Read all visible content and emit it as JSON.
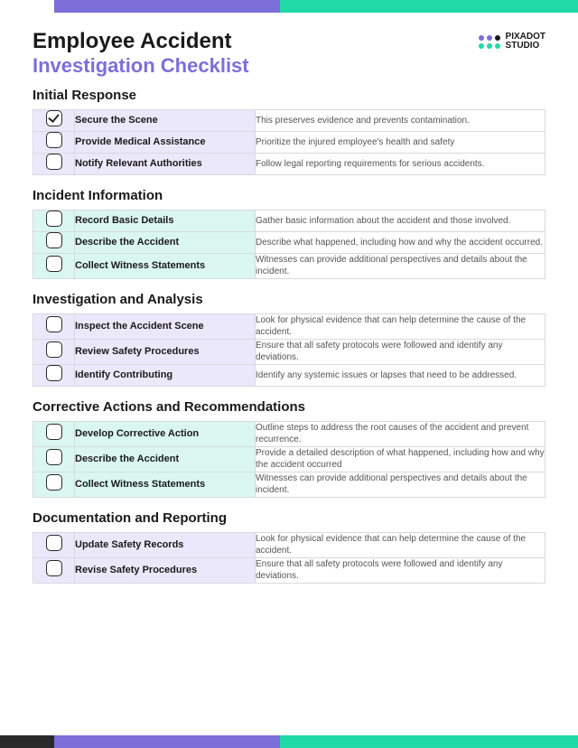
{
  "brand": {
    "line1": "PIXADOT",
    "line2": "STUDIO"
  },
  "title": {
    "line1": "Employee Accident",
    "line2": "Investigation Checklist"
  },
  "sections": [
    {
      "name": "Initial Response",
      "tint": "p",
      "items": [
        {
          "label": "Secure the Scene",
          "desc": "This preserves evidence and prevents contamination.",
          "checked": true
        },
        {
          "label": "Provide Medical Assistance",
          "desc": "Prioritize the injured employee's health and safety",
          "checked": false
        },
        {
          "label": "Notify Relevant Authorities",
          "desc": "Follow legal reporting requirements for serious accidents.",
          "checked": false
        }
      ]
    },
    {
      "name": "Incident Information",
      "tint": "g",
      "items": [
        {
          "label": "Record Basic Details",
          "desc": "Gather basic information about the accident and those involved.",
          "checked": false
        },
        {
          "label": "Describe the Accident",
          "desc": "Describe what happened, including how and why the accident occurred.",
          "checked": false
        },
        {
          "label": "Collect Witness Statements",
          "desc": "Witnesses can provide additional perspectives and details about the incident.",
          "checked": false
        }
      ]
    },
    {
      "name": "Investigation and Analysis",
      "tint": "p",
      "items": [
        {
          "label": "Inspect the Accident Scene",
          "desc": "Look for physical evidence that can help determine the cause of  the accident.",
          "checked": false
        },
        {
          "label": "Review Safety Procedures",
          "desc": "Ensure that all safety protocols were followed and identify any deviations.",
          "checked": false
        },
        {
          "label": "Identify Contributing",
          "desc": "Identify any systemic issues or lapses that need to be addressed.",
          "checked": false
        }
      ]
    },
    {
      "name": "Corrective Actions and Recommendations",
      "tint": "g",
      "items": [
        {
          "label": "Develop Corrective Action",
          "desc": "Outline steps to address the root causes of the accident and prevent recurrence.",
          "checked": false
        },
        {
          "label": "Describe the Accident",
          "desc": "Provide a detailed description of what happened, including how and why the accident occurred",
          "checked": false
        },
        {
          "label": "Collect Witness Statements",
          "desc": "Witnesses can provide additional perspectives and details about the incident.",
          "checked": false
        }
      ]
    },
    {
      "name": "Documentation and Reporting",
      "tint": "p",
      "items": [
        {
          "label": "Update Safety Records",
          "desc": "Look for physical evidence that can help determine the cause of  the accident.",
          "checked": false
        },
        {
          "label": "Revise Safety Procedures",
          "desc": "Ensure that all safety protocols were followed and identify any deviations.",
          "checked": false
        }
      ]
    }
  ]
}
